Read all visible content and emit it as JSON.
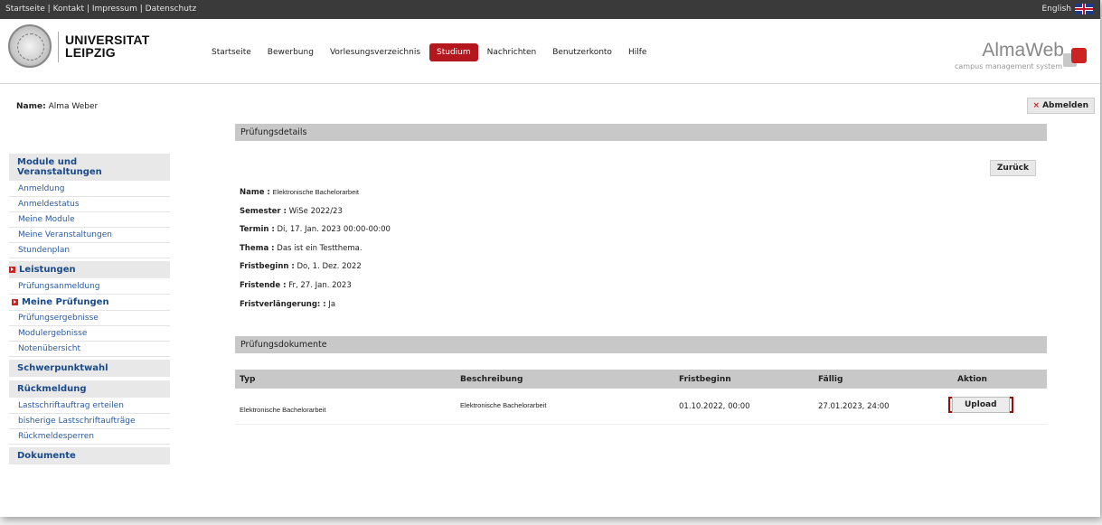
{
  "topbar": {
    "links": [
      "Startseite",
      "Kontakt",
      "Impressum",
      "Datenschutz"
    ],
    "separator": "|",
    "language": "English",
    "flag_icon": "uk-flag-icon"
  },
  "header": {
    "university_line1": "UNIVERSITAT",
    "university_line2": "LEIPZIG",
    "nav": [
      "Startseite",
      "Bewerbung",
      "Vorlesungsverzeichnis",
      "Studium",
      "Nachrichten",
      "Benutzerkonto",
      "Hilfe"
    ],
    "active_nav": "Studium",
    "brand": "AlmaWeb",
    "brand_sub": "campus management system"
  },
  "user": {
    "name_label": "Name:",
    "name_value": "Alma Weber",
    "logout_label": "Abmelden"
  },
  "sidebar": {
    "module_head": "Module und Veranstaltungen",
    "module_items": [
      "Anmeldung",
      "Anmeldestatus",
      "Meine Module",
      "Meine Veranstaltungen",
      "Stundenplan"
    ],
    "leistungen_head": "Leistungen",
    "leistungen_items": [
      "Prüfungsanmeldung",
      "Meine Prüfungen",
      "Prüfungsergebnisse",
      "Modulergebnisse",
      "Notenübersicht"
    ],
    "schwerpunkt_head": "Schwerpunktwahl",
    "rueckmeldung_head": "Rückmeldung",
    "rueckmeldung_items": [
      "Lastschriftauftrag erteilen",
      "bisherige Lastschriftaufträge",
      "Rückmeldesperren"
    ],
    "dokumente_head": "Dokumente"
  },
  "details": {
    "section_title": "Prüfungsdetails",
    "back_button": "Zurück",
    "rows": [
      {
        "label": "Name :",
        "value": "Elektronische Bachelorarbeit"
      },
      {
        "label": "Semester :",
        "value": "WiSe 2022/23"
      },
      {
        "label": "Termin :",
        "value": "Di, 17. Jan. 2023 00:00-00:00"
      },
      {
        "label": "Thema :",
        "value": "Das ist ein Testthema."
      },
      {
        "label": "Fristbeginn :",
        "value": "Do, 1. Dez. 2022"
      },
      {
        "label": "Fristende :",
        "value": "Fr, 27. Jan. 2023"
      },
      {
        "label": "Fristverlängerung: :",
        "value": "Ja"
      }
    ]
  },
  "documents": {
    "section_title": "Prüfungsdokumente",
    "columns": [
      "Typ",
      "Beschreibung",
      "Fristbeginn",
      "Fällig",
      "Aktion"
    ],
    "rows": [
      {
        "typ": "Elektronische Bachelorarbeit",
        "beschreibung": "Elektronische Bachelorarbeit",
        "fristbeginn": "01.10.2022, 00:00",
        "faellig": "27.01.2023, 24:00",
        "aktion": "Upload"
      }
    ]
  },
  "colors": {
    "accent_red": "#b5171e",
    "link_blue": "#2a5aa0",
    "heading_blue": "#1a4a8a",
    "section_grey": "#c8c8c8"
  }
}
